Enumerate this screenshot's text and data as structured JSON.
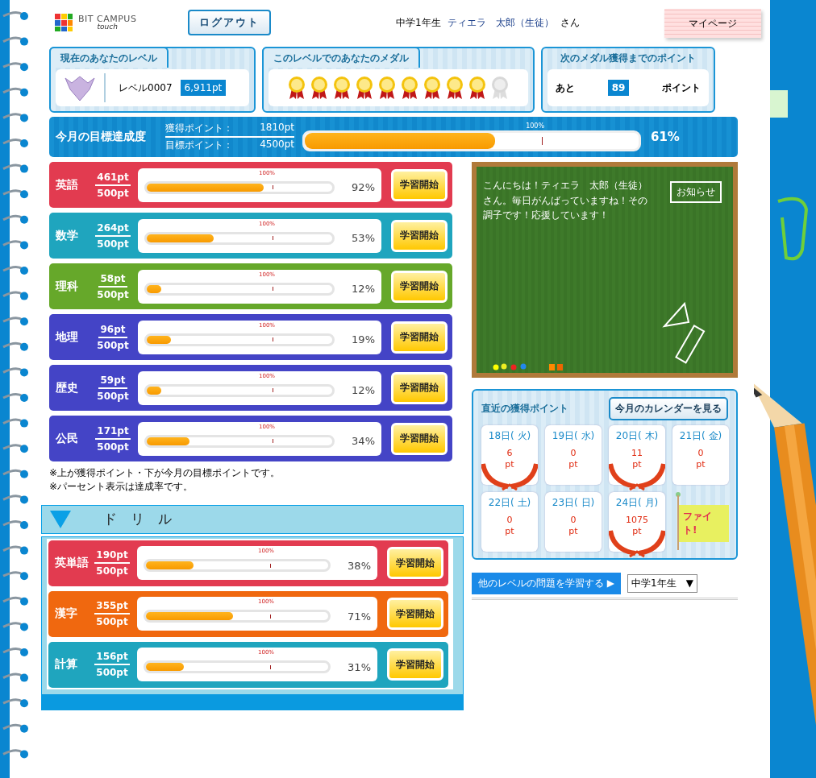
{
  "header": {
    "logo_title": "BIT CAMPUS",
    "logo_sub": "touch",
    "logout": "ログアウト",
    "grade": "中学1年生",
    "user_name": "ティエラ　太郎（生徒）",
    "honorific": "さん",
    "mypage": "マイページ"
  },
  "level_box": {
    "title": "現在のあなたのレベル",
    "level": "レベル0007",
    "points": "6,911pt"
  },
  "medal_box": {
    "title": "このレベルでのあなたのメダル",
    "medals": [
      {
        "earned": true
      },
      {
        "earned": true
      },
      {
        "earned": true
      },
      {
        "earned": true
      },
      {
        "earned": true
      },
      {
        "earned": true
      },
      {
        "earned": true
      },
      {
        "earned": true
      },
      {
        "earned": true
      },
      {
        "earned": false
      }
    ]
  },
  "next_box": {
    "title": "次のメダル獲得までのポイント",
    "prefix": "あと",
    "value": "89",
    "suffix": "ポイント"
  },
  "monthly": {
    "title": "今月の目標達成度",
    "earned_label": "獲得ポイント：",
    "earned": "1810pt",
    "target_label": "目標ポイント：",
    "target": "4500pt",
    "marker": "100%",
    "level": 0.57,
    "percent": "61%"
  },
  "subjects": [
    {
      "name": "英語",
      "earned": "461pt",
      "target": "500pt",
      "marker": "100%",
      "level": 0.63,
      "percent": "92%",
      "button": "学習開始",
      "color": "#e23b50"
    },
    {
      "name": "数学",
      "earned": "264pt",
      "target": "500pt",
      "marker": "100%",
      "level": 0.36,
      "percent": "53%",
      "button": "学習開始",
      "color": "#1fa5be"
    },
    {
      "name": "理科",
      "earned": "58pt",
      "target": "500pt",
      "marker": "100%",
      "level": 0.08,
      "percent": "12%",
      "button": "学習開始",
      "color": "#66a82a"
    },
    {
      "name": "地理",
      "earned": "96pt",
      "target": "500pt",
      "marker": "100%",
      "level": 0.13,
      "percent": "19%",
      "button": "学習開始",
      "color": "#4444c6"
    },
    {
      "name": "歴史",
      "earned": "59pt",
      "target": "500pt",
      "marker": "100%",
      "level": 0.08,
      "percent": "12%",
      "button": "学習開始",
      "color": "#4444c6"
    },
    {
      "name": "公民",
      "earned": "171pt",
      "target": "500pt",
      "marker": "100%",
      "level": 0.23,
      "percent": "34%",
      "button": "学習開始",
      "color": "#4444c6"
    }
  ],
  "notes": [
    "※上が獲得ポイント・下が今月の目標ポイントです。",
    "※パーセント表示は達成率です。"
  ],
  "drill": {
    "title": "ド　リ　ル",
    "expanded": true,
    "items": [
      {
        "name": "英単語",
        "earned": "190pt",
        "target": "500pt",
        "marker": "100%",
        "level": 0.26,
        "percent": "38%",
        "button": "学習開始",
        "color": "#e23b50"
      },
      {
        "name": "漢字",
        "earned": "355pt",
        "target": "500pt",
        "marker": "100%",
        "level": 0.48,
        "percent": "71%",
        "button": "学習開始",
        "color": "#f0680f"
      },
      {
        "name": "計算",
        "earned": "156pt",
        "target": "500pt",
        "marker": "100%",
        "level": 0.21,
        "percent": "31%",
        "button": "学習開始",
        "color": "#1fa5be"
      }
    ]
  },
  "blackboard": {
    "message": "こんにちは！ティエラ　太郎（生徒）さん。毎日がんばっていますね！その調子です！応援しています！",
    "sign": "お知らせ"
  },
  "recent": {
    "title": "直近の獲得ポイント",
    "calendar_button": "今月のカレンダーを見る",
    "days": [
      {
        "date": "18日( 火)",
        "points": "6",
        "unit": "pt",
        "wreath": true
      },
      {
        "date": "19日( 水)",
        "points": "0",
        "unit": "pt",
        "wreath": false
      },
      {
        "date": "20日( 木)",
        "points": "11",
        "unit": "pt",
        "wreath": true
      },
      {
        "date": "21日( 金)",
        "points": "0",
        "unit": "pt",
        "wreath": false
      },
      {
        "date": "22日( 土)",
        "points": "0",
        "unit": "pt",
        "wreath": false
      },
      {
        "date": "23日( 日)",
        "points": "0",
        "unit": "pt",
        "wreath": false
      },
      {
        "date": "24日( 月)",
        "points": "1075",
        "unit": "pt",
        "wreath": true
      }
    ],
    "flag": "ファイト!"
  },
  "other_level": {
    "label": "他のレベルの問題を学習する",
    "arrow": "▶",
    "grade": "中学1年生",
    "caret": "▼"
  }
}
